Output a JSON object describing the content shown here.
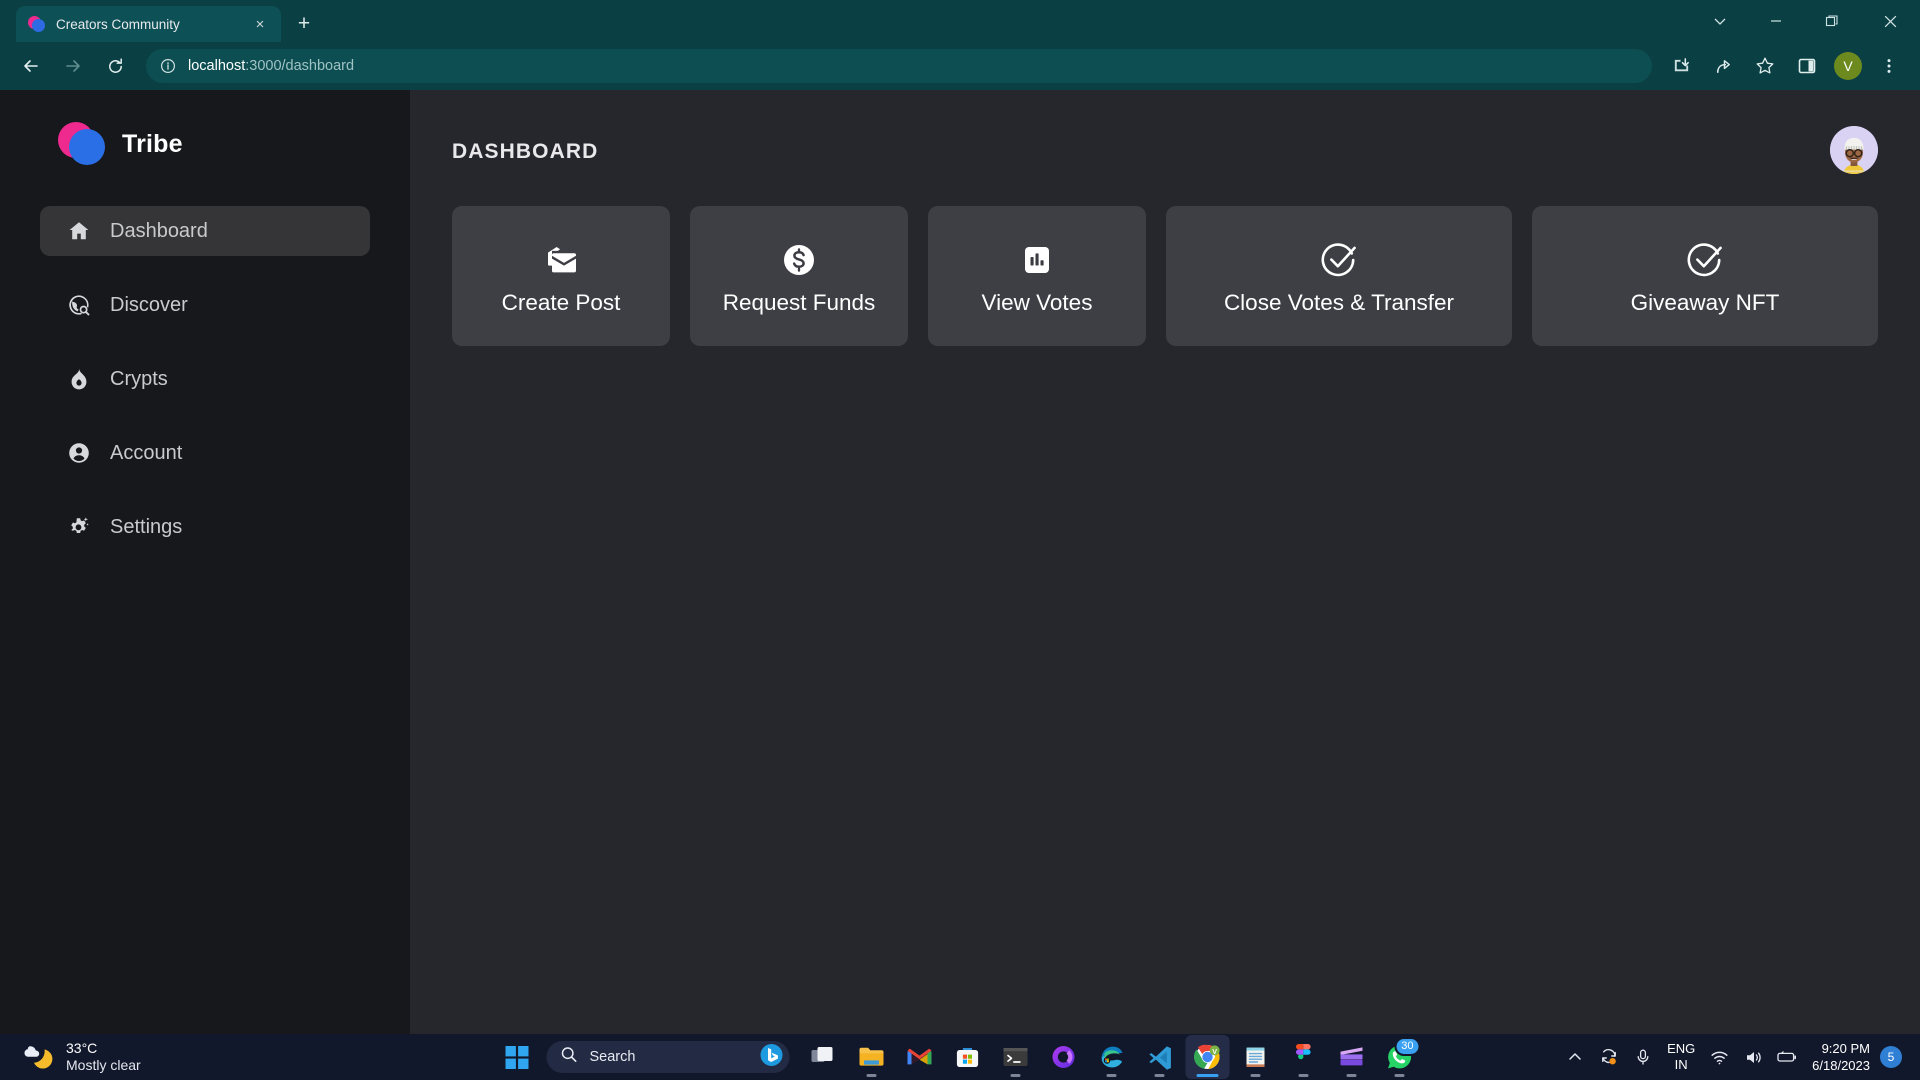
{
  "browser": {
    "tab": {
      "title": "Creators Community",
      "favicon": "tribe-logo-icon",
      "close": "×"
    },
    "new_tab_label": "+",
    "window_controls": [
      "tab-search-chevron-icon",
      "minimize-icon",
      "restore-icon",
      "close-icon"
    ],
    "nav": {
      "back": "back-icon",
      "forward": "forward-icon",
      "reload": "reload-icon"
    },
    "omnibox": {
      "site_info": "info-icon",
      "host": "localhost",
      "path": ":3000/dashboard",
      "full_url": "localhost:3000/dashboard"
    },
    "toolbar_icons": [
      "install-app-icon",
      "share-icon",
      "bookmark-star-icon",
      "side-panel-icon",
      "profile-avatar",
      "more-menu-icon"
    ],
    "profile_initial": "V"
  },
  "sidebar": {
    "brand": "Tribe",
    "items": [
      {
        "label": "Dashboard",
        "icon": "home-icon",
        "active": true
      },
      {
        "label": "Discover",
        "icon": "globe-search-icon",
        "active": false
      },
      {
        "label": "Crypts",
        "icon": "flame-icon",
        "active": false
      },
      {
        "label": "Account",
        "icon": "user-circle-icon",
        "active": false
      },
      {
        "label": "Settings",
        "icon": "gear-sparkle-icon",
        "active": false
      }
    ]
  },
  "main": {
    "page_title": "DASHBOARD",
    "avatar": "user-avatar",
    "cards": [
      {
        "label": "Create Post",
        "icon": "mail-stack-icon"
      },
      {
        "label": "Request Funds",
        "icon": "dollar-coin-icon"
      },
      {
        "label": "View Votes",
        "icon": "bar-chart-icon"
      },
      {
        "label": "Close Votes & Transfer",
        "icon": "check-circle-icon"
      },
      {
        "label": "Giveaway NFT",
        "icon": "check-circle-icon"
      }
    ]
  },
  "taskbar": {
    "weather": {
      "temperature": "33°C",
      "condition": "Mostly clear",
      "icon": "moon-cloud-icon"
    },
    "start": "windows-start-icon",
    "search": {
      "placeholder": "Search",
      "icon": "search-icon",
      "assistant_icon": "bing-icon"
    },
    "apps": [
      {
        "name": "task-view",
        "badge": ""
      },
      {
        "name": "file-explorer",
        "badge": ""
      },
      {
        "name": "gmail",
        "badge": ""
      },
      {
        "name": "microsoft-store",
        "badge": ""
      },
      {
        "name": "terminal",
        "badge": ""
      },
      {
        "name": "phone-link",
        "badge": ""
      },
      {
        "name": "microsoft-edge",
        "badge": ""
      },
      {
        "name": "vs-code",
        "badge": ""
      },
      {
        "name": "google-chrome",
        "badge": ""
      },
      {
        "name": "notepad",
        "badge": ""
      },
      {
        "name": "figma",
        "badge": ""
      },
      {
        "name": "media-app",
        "badge": ""
      },
      {
        "name": "whatsapp",
        "badge": "30"
      }
    ],
    "tray": {
      "show_hidden": "chevron-up-icon",
      "sync": "sync-icon",
      "mic": "microphone-icon",
      "language": "ENG",
      "region": "IN",
      "wifi": "wifi-icon",
      "volume": "volume-icon",
      "battery": "battery-icon",
      "time": "9:20 PM",
      "date": "6/18/2023",
      "notification_count": "5"
    }
  },
  "colors": {
    "browser_chrome": "#0a4044",
    "sidebar_bg": "#17181c",
    "content_bg": "#26262d",
    "card_bg": "#3e3e45",
    "brand_pink": "#ee2a8e",
    "brand_blue": "#2b6fe6",
    "taskbar_bg": "#12182b",
    "accent_blue": "#3aa0f2"
  }
}
